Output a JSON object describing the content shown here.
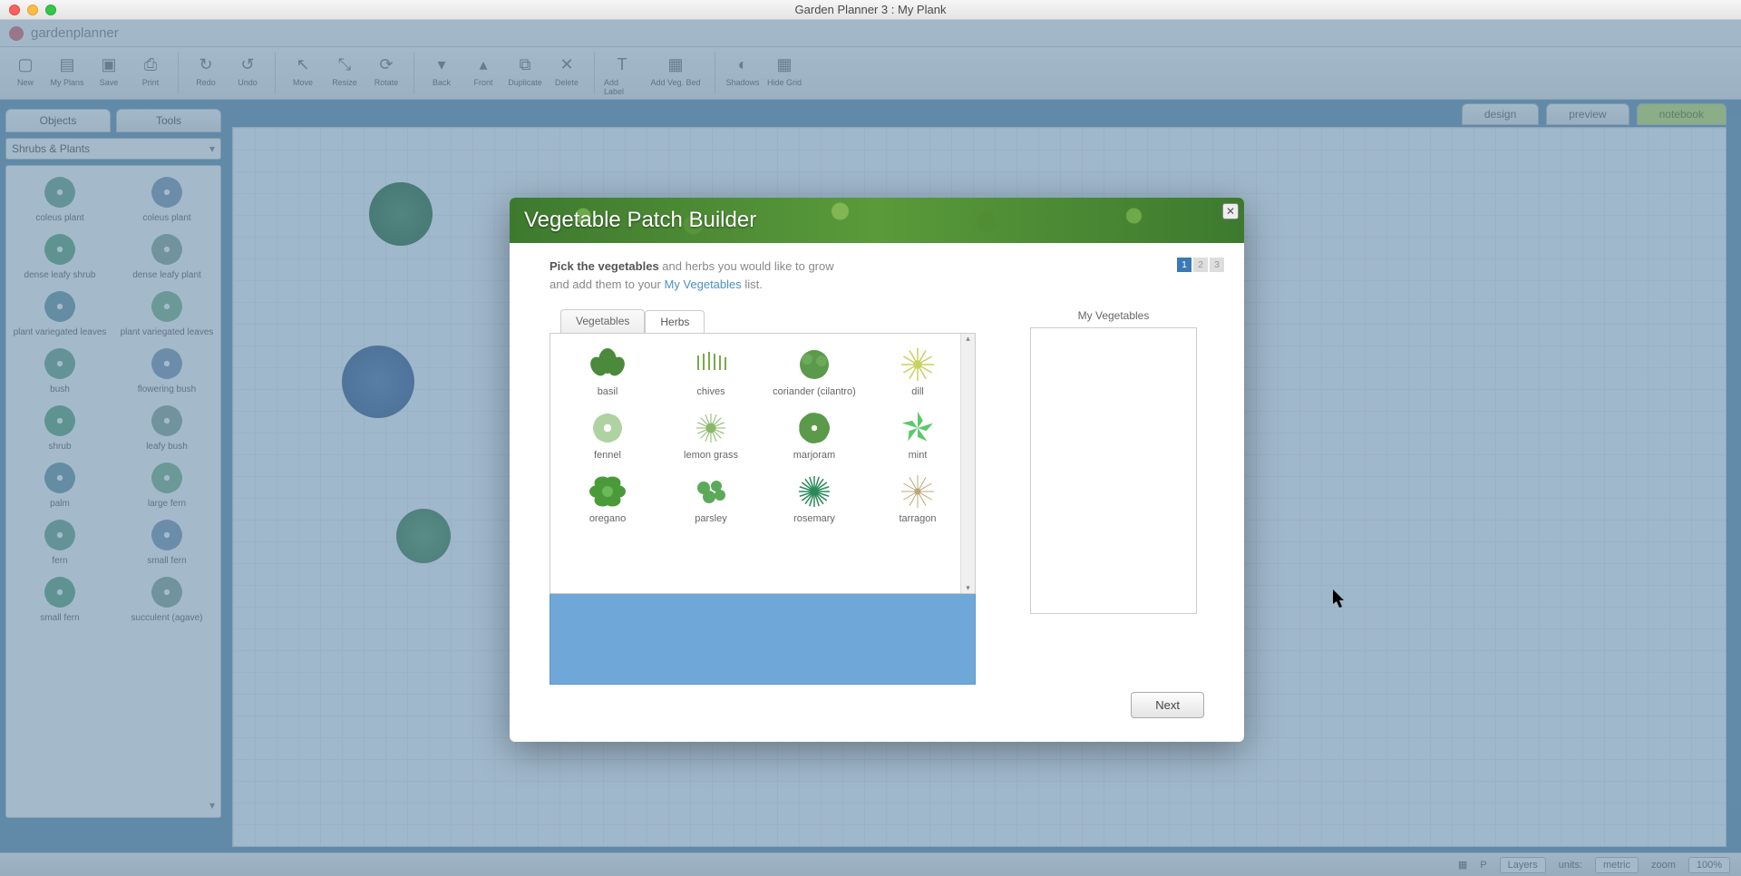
{
  "window": {
    "title": "Garden Planner 3 : My  Plank"
  },
  "app": {
    "brand": "gardenplanner"
  },
  "toolbar": {
    "groups": [
      [
        "New",
        "My Plans",
        "Save",
        "Print"
      ],
      [
        "Redo",
        "Undo"
      ],
      [
        "Move",
        "Resize",
        "Rotate"
      ],
      [
        "Back",
        "Front",
        "Duplicate",
        "Delete"
      ],
      [
        "Add Label",
        "Add Veg. Bed"
      ],
      [
        "Shadows",
        "Hide Grid"
      ]
    ]
  },
  "leftpanel": {
    "tabs": [
      "Objects",
      "Tools"
    ],
    "active_tab": 0,
    "category": "Shrubs & Plants",
    "items": [
      "coleus plant",
      "coleus plant",
      "dense leafy shrub",
      "dense leafy plant",
      "plant variegated leaves",
      "plant variegated leaves",
      "bush",
      "flowering bush",
      "shrub",
      "leafy bush",
      "palm",
      "large fern",
      "fern",
      "small fern",
      "small fern",
      "succulent (agave)"
    ]
  },
  "viewtabs": {
    "items": [
      "design",
      "preview",
      "notebook"
    ],
    "active": 0
  },
  "statusbar": {
    "layers": "Layers",
    "units_label": "units:",
    "units_value": "metric",
    "zoom_label": "zoom",
    "zoom_value": "100%"
  },
  "modal": {
    "title": "Vegetable Patch Builder",
    "steps": [
      "1",
      "2",
      "3"
    ],
    "active_step": 0,
    "instruction_bold": "Pick the vegetables",
    "instruction_rest1": " and herbs you would like to grow",
    "instruction_rest2": "and add them to your ",
    "instruction_link": "My Vegetables",
    "instruction_rest3": " list.",
    "picker_tabs": [
      "Vegetables",
      "Herbs"
    ],
    "picker_active": 1,
    "herbs": [
      "basil",
      "chives",
      "coriander (cilantro)",
      "dill",
      "fennel",
      "lemon grass",
      "marjoram",
      "mint",
      "oregano",
      "parsley",
      "rosemary",
      "tarragon"
    ],
    "my_label": "My Vegetables",
    "next": "Next"
  }
}
